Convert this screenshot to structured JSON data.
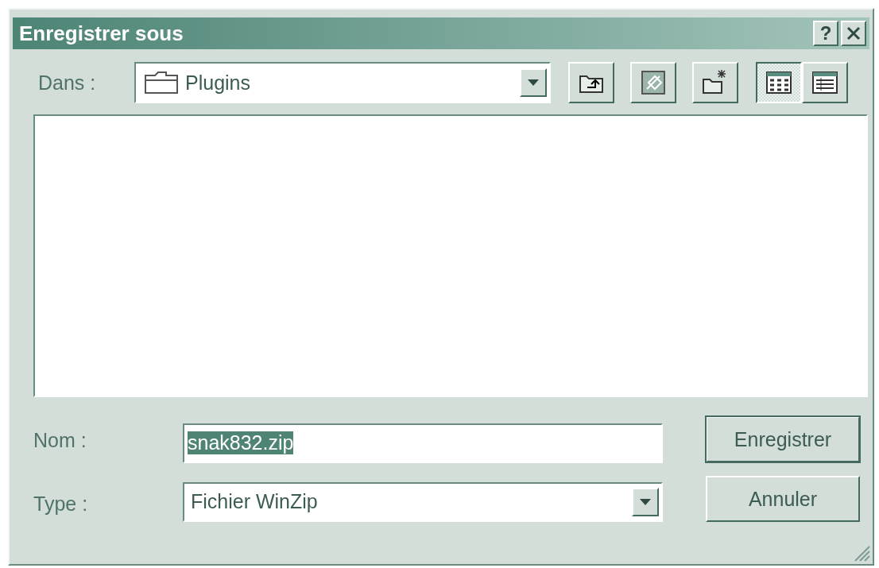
{
  "window": {
    "title": "Enregistrer sous",
    "help": "?"
  },
  "location": {
    "label": "Dans :",
    "value": "Plugins"
  },
  "toolbar": [
    {
      "kind": "up-folder",
      "selected": false
    },
    {
      "kind": "desktop",
      "selected": false
    },
    {
      "kind": "new-folder",
      "selected": false
    },
    {
      "kind": "list-view",
      "selected": true
    },
    {
      "kind": "details-view",
      "selected": false
    }
  ],
  "file_name": {
    "label": "Nom :",
    "value": "snak832.zip",
    "selected": true
  },
  "file_type": {
    "label": "Type :",
    "value": "Fichier WinZip"
  },
  "buttons": [
    {
      "label": "Enregistrer",
      "default": true
    },
    {
      "label": "Annuler",
      "default": false
    }
  ]
}
